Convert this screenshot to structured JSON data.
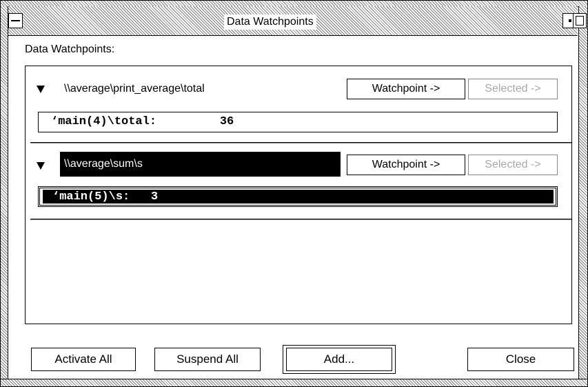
{
  "window": {
    "title": "Data Watchpoints"
  },
  "content": {
    "section_label": "Data Watchpoints:"
  },
  "watchpoints": [
    {
      "path": "\\\\average\\print_average\\total",
      "value": "‘main(4)\\total:         36",
      "selected": false,
      "watchpoint_button": "Watchpoint ->",
      "selected_button": "Selected ->"
    },
    {
      "path": "\\\\average\\sum\\s",
      "value": "‘main(5)\\s:   3",
      "selected": true,
      "watchpoint_button": "Watchpoint ->",
      "selected_button": "Selected ->"
    }
  ],
  "buttons": {
    "activate_all": "Activate All",
    "suspend_all": "Suspend All",
    "add": "Add...",
    "close": "Close"
  },
  "icons": {
    "window_menu": "window-menu-icon",
    "minimize": "minimize-icon",
    "maximize": "maximize-icon",
    "expand": "triangle-down-icon"
  },
  "colors": {
    "selection_background": "#000000",
    "selection_text": "#ffffff",
    "disabled_text": "#a8a8a8"
  }
}
